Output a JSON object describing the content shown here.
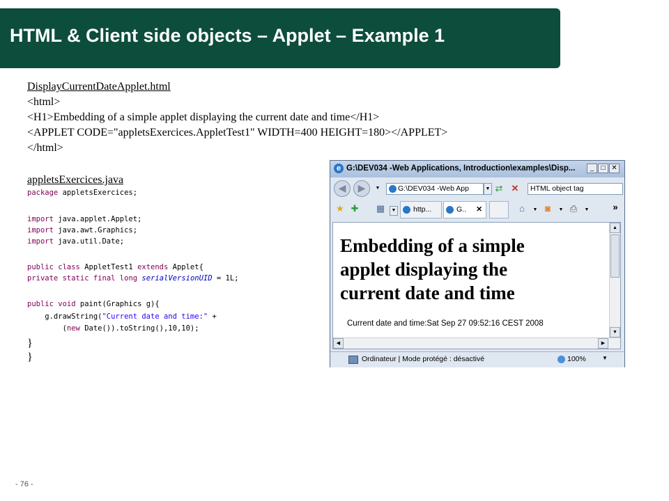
{
  "slide": {
    "title": "HTML & Client side objects – Applet – Example 1",
    "page_number": "- 76 -"
  },
  "html_file": {
    "filename": "DisplayCurrentDateApplet.html",
    "lines": [
      "<html>",
      "<H1>Embedding of a simple applet displaying the current date and time</H1>",
      "<APPLET CODE=\"appletsExercices.AppletTest1\"  WIDTH=400 HEIGHT=180></APPLET>",
      "</html>"
    ]
  },
  "java_file": {
    "filename": "appletsExercices.java",
    "package_kw": "package",
    "package_rest": " appletsExercices;",
    "import_kw": "import",
    "imports": [
      " java.applet.Applet;",
      " java.awt.Graphics;",
      " java.util.Date;"
    ],
    "class_line": {
      "k1": "public",
      "k2": "class",
      "name": " AppletTest1 ",
      "k3": "extends",
      "rest": " Applet{"
    },
    "field_line": {
      "k1": "private",
      "k2": "static",
      "k3": "final",
      "k4": "long",
      "field": "serialVersionUID",
      "rest": " = 1L;"
    },
    "method_line": {
      "k1": "public",
      "k2": "void",
      "rest": " paint(Graphics g){"
    },
    "draw_line": {
      "pre": "    g.drawString(",
      "str": "\"Current date and time:\"",
      "post": " +"
    },
    "new_line": {
      "pre": "        (",
      "kw": "new",
      "post": " Date()).toString(),10,10);"
    },
    "close1": " }",
    "close2": "}"
  },
  "browser": {
    "window_title": "G:\\DEV034 -Web Applications, Introduction\\examples\\Disp...",
    "address": "G:\\DEV034 -Web App",
    "search_value": "HTML object tag",
    "tabs": [
      "http...",
      "G.."
    ],
    "page_heading": "Embedding of a simple applet displaying the current date and time",
    "heading_lines": [
      "Embedding of a simple",
      "applet displaying the",
      "current date and time"
    ],
    "applet_output": "Current date and time:Sat Sep 27 09:52:16 CEST 2008",
    "status_text": "Ordinateur | Mode protégé : désactivé",
    "zoom": "100%"
  }
}
